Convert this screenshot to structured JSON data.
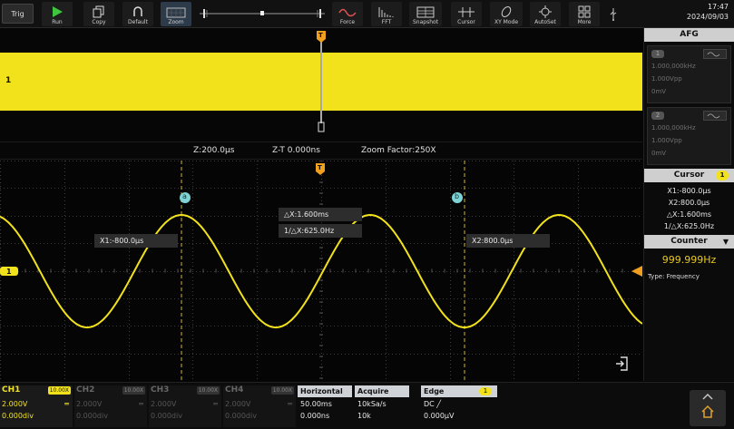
{
  "toolbar": {
    "trig": "Trig",
    "run": "Run",
    "copy": "Copy",
    "default": "Default",
    "zoom": "Zoom",
    "force": "Force",
    "fft": "FFT",
    "snapshot": "Snapshot",
    "cursor": "Cursor",
    "xy_mode": "XY Mode",
    "autoset": "AutoSet",
    "more": "More"
  },
  "clock": {
    "time": "17:47",
    "date": "2024/09/03"
  },
  "overview": {
    "channel_marker": "1",
    "trigger_marker": "T"
  },
  "zoom_info": {
    "z": "Z:200.0µs",
    "zt": "Z-T 0.000ns",
    "factor": "Zoom Factor:250X"
  },
  "zoom_window": {
    "x1": "X1:-800.0µs",
    "x2": "X2:800.0µs",
    "delta_x": "△X:1.600ms",
    "inv_delta_x": "1/△X:625.0Hz",
    "channel_marker": "1",
    "cursor_a": "a",
    "cursor_b": "b"
  },
  "afg": {
    "title": "AFG",
    "channels": [
      {
        "id": "1",
        "freq": "1.000,000kHz",
        "amp": "1.000Vpp",
        "offset": "0mV"
      },
      {
        "id": "2",
        "freq": "1.000,000kHz",
        "amp": "1.000Vpp",
        "offset": "0mV"
      }
    ]
  },
  "cursor_panel": {
    "title": "Cursor",
    "badge": "1",
    "x1": "X1:-800.0µs",
    "x2": "X2:800.0µs",
    "delta_x": "△X:1.600ms",
    "inv_delta_x": "1/△X:625.0Hz"
  },
  "counter": {
    "title": "Counter",
    "value": "999.999Hz",
    "type_label": "Type:",
    "type_value": "Frequency"
  },
  "channels": [
    {
      "name": "CH1",
      "tag": "10.00X",
      "v1": "2.000V",
      "v2": "0.000div",
      "mark": "═",
      "color": "#f2e21b",
      "active": true
    },
    {
      "name": "CH2",
      "tag": "10.00X",
      "v1": "2.000V",
      "v2": "0.000div",
      "mark": "═",
      "color": "#5a5a5a",
      "active": false
    },
    {
      "name": "CH3",
      "tag": "10.00X",
      "v1": "2.000V",
      "v2": "0.000div",
      "mark": "═",
      "color": "#5a5a5a",
      "active": false
    },
    {
      "name": "CH4",
      "tag": "10.00X",
      "v1": "2.000V",
      "v2": "0.000div",
      "mark": "═",
      "color": "#5a5a5a",
      "active": false
    }
  ],
  "horizontal": {
    "title": "Horizontal",
    "r1": "50.00ms",
    "r2": "0.000ns"
  },
  "acquire": {
    "title": "Acquire",
    "r1": "10kSa/s",
    "r2": "10k"
  },
  "edge": {
    "title": "Edge",
    "badge": "1",
    "r1": "DC ╱",
    "r2": "0.000µV"
  },
  "colors": {
    "ch1": "#f2e21b",
    "cursor": "#7fd3d6",
    "trigger": "#f0a01e"
  },
  "icons": {
    "run": "play-icon",
    "copy": "copy-icon",
    "default": "default-icon",
    "zoom": "zoom-icon",
    "force": "force-icon",
    "fft": "fft-icon",
    "snapshot": "snapshot-icon",
    "cursor": "cursor-icon",
    "xy_mode": "xy-mode-icon",
    "autoset": "autoset-icon",
    "more": "more-icon",
    "usb": "usb-icon",
    "exit": "exit-icon",
    "home": "home-icon"
  }
}
